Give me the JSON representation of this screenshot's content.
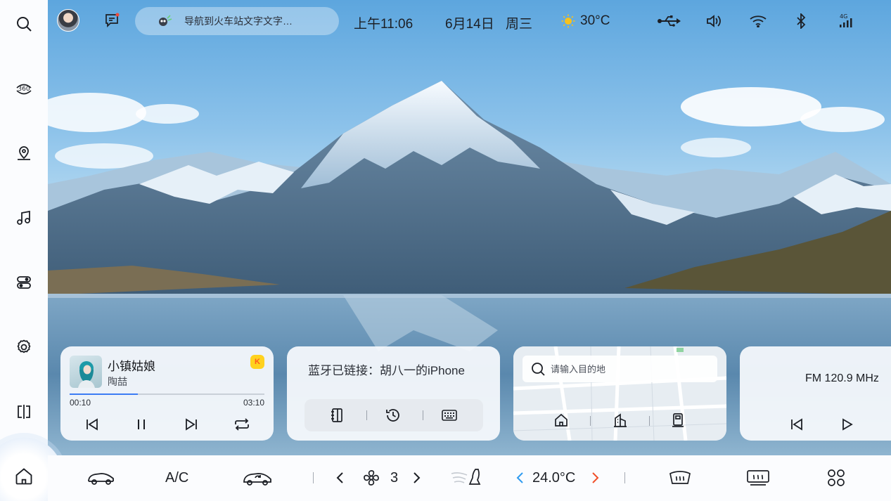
{
  "top_bar": {
    "nav_prompt": "导航到火车站文字文字…",
    "time": "上午11:06",
    "date": "6月14日",
    "weekday": "周三",
    "temperature": "30°C",
    "network_label": "4G"
  },
  "music": {
    "title": "小镇姑娘",
    "artist": "陶喆",
    "app_badge": "K",
    "elapsed": "00:10",
    "duration": "03:10",
    "progress_fraction": 0.35
  },
  "bluetooth": {
    "status": "蓝牙已链接：胡八一的iPhone"
  },
  "navigation": {
    "search_placeholder": "请输入目的地"
  },
  "radio": {
    "frequency": "FM 120.9 MHz"
  },
  "climate": {
    "ac_label": "A/C",
    "fan_level": "3",
    "temperature": "24.0°C"
  },
  "colors": {
    "accent_blue": "#3b7cf4",
    "temp_left_arrow": "#2f9bf0",
    "temp_right_arrow": "#f0502a",
    "sun": "#f8c21c"
  },
  "icons": {
    "sidebar": [
      "search-icon",
      "360-view-icon",
      "location-icon",
      "music-icon",
      "toggle-settings-icon",
      "gear-icon",
      "split-screen-icon",
      "home-icon"
    ],
    "bottom": [
      "car-front-icon",
      "car-recirculation-icon",
      "fan-icon",
      "seat-airflow-icon",
      "front-defrost-icon",
      "rear-defrost-icon",
      "app-grid-icon"
    ]
  }
}
